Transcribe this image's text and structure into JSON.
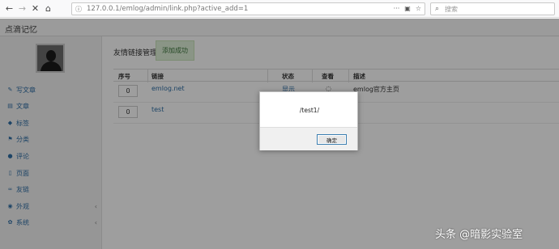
{
  "browser": {
    "url": "127.0.0.1/emlog/admin/link.php?active_add=1",
    "search_placeholder": "搜索",
    "icons": [
      "back-icon",
      "forward-icon",
      "stop-icon",
      "home-icon",
      "info-icon",
      "menu-dots-icon",
      "pocket-icon",
      "bookmark-star-icon",
      "search-icon"
    ]
  },
  "app": {
    "title": "点滴记忆"
  },
  "sidebar": {
    "items": [
      {
        "label": "写文章",
        "icon": "pencil-icon",
        "glyph": "✎"
      },
      {
        "label": "文章",
        "icon": "list-icon",
        "glyph": "▤"
      },
      {
        "label": "标签",
        "icon": "tag-icon",
        "glyph": "◆"
      },
      {
        "label": "分类",
        "icon": "flag-icon",
        "glyph": "⚑"
      },
      {
        "label": "评论",
        "icon": "comment-icon",
        "glyph": "●"
      },
      {
        "label": "页面",
        "icon": "file-icon",
        "glyph": "▯"
      },
      {
        "label": "友链",
        "icon": "link-icon",
        "glyph": "∞"
      },
      {
        "label": "外观",
        "icon": "eye-icon",
        "glyph": "◉",
        "arrow": "‹"
      },
      {
        "label": "系统",
        "icon": "gear-icon",
        "glyph": "✿",
        "arrow": "‹"
      }
    ]
  },
  "main": {
    "page_title": "友情链接管理",
    "success_badge": "添加成功",
    "table": {
      "headers": [
        "序号",
        "链接",
        "状态",
        "查看",
        "描述"
      ],
      "rows": [
        {
          "order": "0",
          "link": "emlog.net",
          "status": "显示",
          "view": "◌",
          "desc": "emlog官方主页"
        },
        {
          "order": "0",
          "link": "test",
          "status": "",
          "view": "",
          "desc": ""
        }
      ]
    }
  },
  "dialog": {
    "message": "/test1/",
    "ok_label": "确定"
  },
  "watermark": "头条 @暗影实验室",
  "colors": {
    "link": "#2f6ea5",
    "success_bg": "#dff0d8",
    "success_text": "#3c763d"
  }
}
